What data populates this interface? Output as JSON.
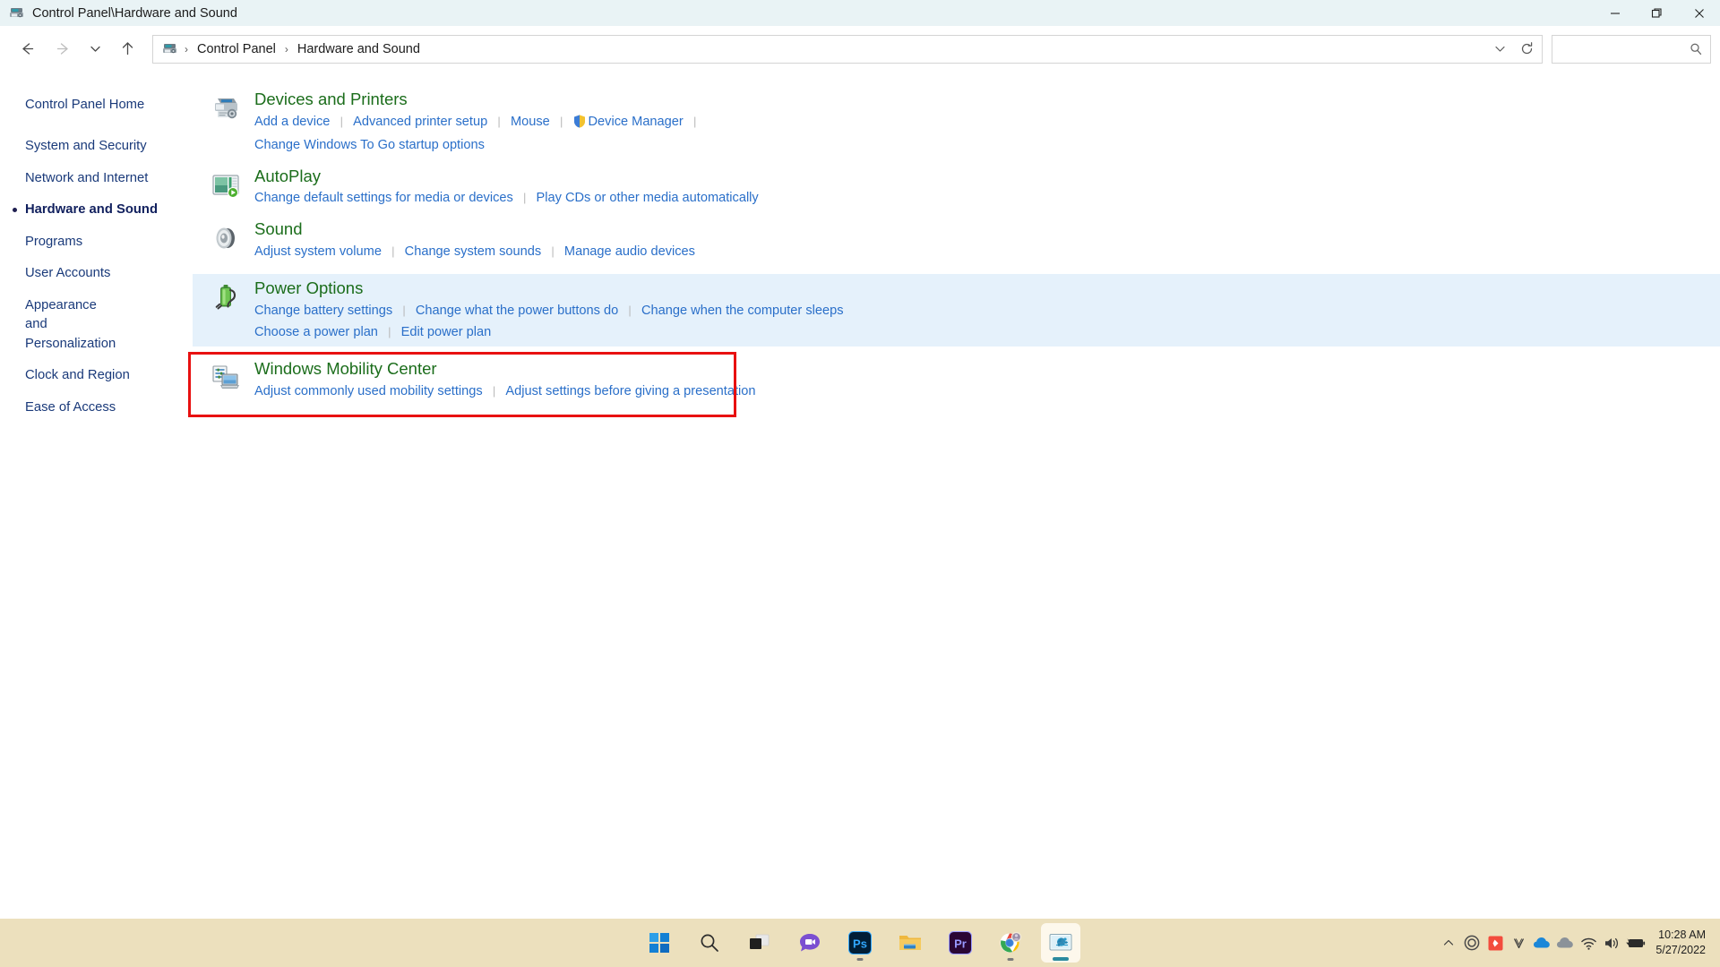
{
  "window": {
    "title": "Control Panel\\Hardware and Sound",
    "icon": "control-panel-icon",
    "minimize_label": "—",
    "maximize_label": "❐",
    "close_label": "✕"
  },
  "nav": {
    "back_label": "←",
    "forward_label": "→",
    "recent_label": "⌄",
    "up_label": "↑",
    "breadcrumbs": [
      "Control Panel",
      "Hardware and Sound"
    ],
    "separator": "›",
    "dropdown_label": "⌄",
    "refresh_label": "↻"
  },
  "search": {
    "value": "",
    "placeholder": "",
    "icon": "search-icon"
  },
  "sidebar": {
    "home": "Control Panel Home",
    "items": [
      {
        "label": "System and Security",
        "current": false
      },
      {
        "label": "Network and Internet",
        "current": false
      },
      {
        "label": "Hardware and Sound",
        "current": true
      },
      {
        "label": "Programs",
        "current": false
      },
      {
        "label": "User Accounts",
        "current": false
      },
      {
        "label": "Appearance and Personalization",
        "current": false
      },
      {
        "label": "Clock and Region",
        "current": false
      },
      {
        "label": "Ease of Access",
        "current": false
      }
    ]
  },
  "categories": [
    {
      "title": "Devices and Printers",
      "icon": "printer-icon",
      "highlighted": false,
      "rows": [
        [
          {
            "label": "Add a device",
            "shield": false
          },
          {
            "label": "Advanced printer setup",
            "shield": false
          },
          {
            "label": "Mouse",
            "shield": false
          },
          {
            "label": "Device Manager",
            "shield": true
          }
        ],
        [
          {
            "label": "Change Windows To Go startup options",
            "shield": false
          }
        ]
      ]
    },
    {
      "title": "AutoPlay",
      "icon": "autoplay-icon",
      "highlighted": false,
      "rows": [
        [
          {
            "label": "Change default settings for media or devices",
            "shield": false
          },
          {
            "label": "Play CDs or other media automatically",
            "shield": false
          }
        ]
      ]
    },
    {
      "title": "Sound",
      "icon": "speaker-icon",
      "highlighted": false,
      "rows": [
        [
          {
            "label": "Adjust system volume",
            "shield": false
          },
          {
            "label": "Change system sounds",
            "shield": false
          },
          {
            "label": "Manage audio devices",
            "shield": false
          }
        ]
      ]
    },
    {
      "title": "Power Options",
      "icon": "battery-icon",
      "highlighted": true,
      "rows": [
        [
          {
            "label": "Change battery settings",
            "shield": false
          },
          {
            "label": "Change what the power buttons do",
            "shield": false
          },
          {
            "label": "Change when the computer sleeps",
            "shield": false
          }
        ],
        [
          {
            "label": "Choose a power plan",
            "shield": false
          },
          {
            "label": "Edit power plan",
            "shield": false
          }
        ]
      ]
    },
    {
      "title": "Windows Mobility Center",
      "icon": "mobility-center-icon",
      "highlighted": false,
      "rows": [
        [
          {
            "label": "Adjust commonly used mobility settings",
            "shield": false
          },
          {
            "label": "Adjust settings before giving a presentation",
            "shield": false
          }
        ]
      ]
    }
  ],
  "annotation": {
    "type": "red-rectangle-highlight",
    "target": "Power Options"
  },
  "taskbar": {
    "apps": [
      {
        "name": "start-button",
        "label": "Start",
        "running": false
      },
      {
        "name": "search-taskbar-icon",
        "label": "Search",
        "running": false
      },
      {
        "name": "task-view-icon",
        "label": "Task View",
        "running": false
      },
      {
        "name": "chat-icon",
        "label": "Chat",
        "running": false
      },
      {
        "name": "photoshop-icon",
        "label": "Ps",
        "running": true
      },
      {
        "name": "file-explorer-icon",
        "label": "File Explorer",
        "running": false
      },
      {
        "name": "premiere-pro-icon",
        "label": "Pr",
        "running": false
      },
      {
        "name": "chrome-icon",
        "label": "Google Chrome",
        "running": true
      },
      {
        "name": "control-panel-taskbar-icon",
        "label": "Control Panel",
        "running": true
      }
    ],
    "tray": [
      {
        "name": "show-hidden-icons",
        "label": "⌃"
      },
      {
        "name": "creative-cloud-icon",
        "label": "cc"
      },
      {
        "name": "express-vpn-icon",
        "label": "vpn"
      },
      {
        "name": "vmware-icon",
        "label": "V"
      },
      {
        "name": "onedrive-personal-icon",
        "label": "onedrive"
      },
      {
        "name": "onedrive-work-icon",
        "label": "onedrive2"
      },
      {
        "name": "wifi-icon",
        "label": "wifi"
      },
      {
        "name": "volume-icon",
        "label": "volume"
      },
      {
        "name": "battery-charging-icon",
        "label": "battery"
      }
    ],
    "time": "10:28 AM",
    "date": "5/27/2022"
  },
  "colors": {
    "titlebar_bg": "#e9f3f5",
    "category_title": "#1b6d1b",
    "link": "#2a6fc9",
    "sidebar_link": "#1a3a7a",
    "highlight_bg": "#e5f1fb",
    "annotation_red": "#e81010",
    "taskbar_bg": "#ece0bd"
  }
}
